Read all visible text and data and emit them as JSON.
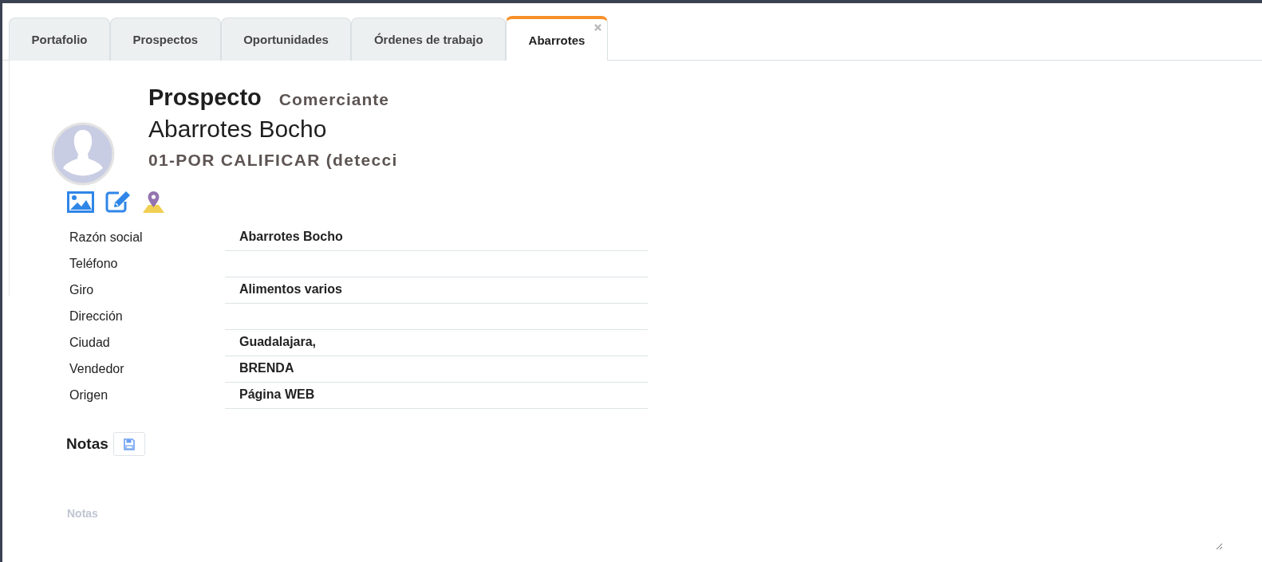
{
  "tabs": [
    {
      "label": "Portafolio",
      "selected": false,
      "closable": false
    },
    {
      "label": "Prospectos",
      "selected": false,
      "closable": false
    },
    {
      "label": "Oportunidades",
      "selected": false,
      "closable": false
    },
    {
      "label": "Órdenes de trabajo",
      "selected": false,
      "closable": false
    },
    {
      "label": "Abarrotes",
      "selected": true,
      "closable": true
    }
  ],
  "header": {
    "title": "Prospecto",
    "type": "Comerciante",
    "name": "Abarrotes Bocho",
    "status": "01-POR CALIFICAR (detecci"
  },
  "fields": [
    {
      "label": "Razón social",
      "value": "Abarrotes Bocho"
    },
    {
      "label": "Teléfono"
    },
    {
      "label": "Giro",
      "value": "Alimentos varios"
    },
    {
      "label": "Dirección"
    },
    {
      "label": "Ciudad",
      "value": "Guadalajara,"
    },
    {
      "label": "Vendedor",
      "value": "BRENDA"
    },
    {
      "label": "Origen",
      "value": "Página WEB"
    }
  ],
  "notes": {
    "title": "Notas",
    "placeholder": "Notas"
  }
}
